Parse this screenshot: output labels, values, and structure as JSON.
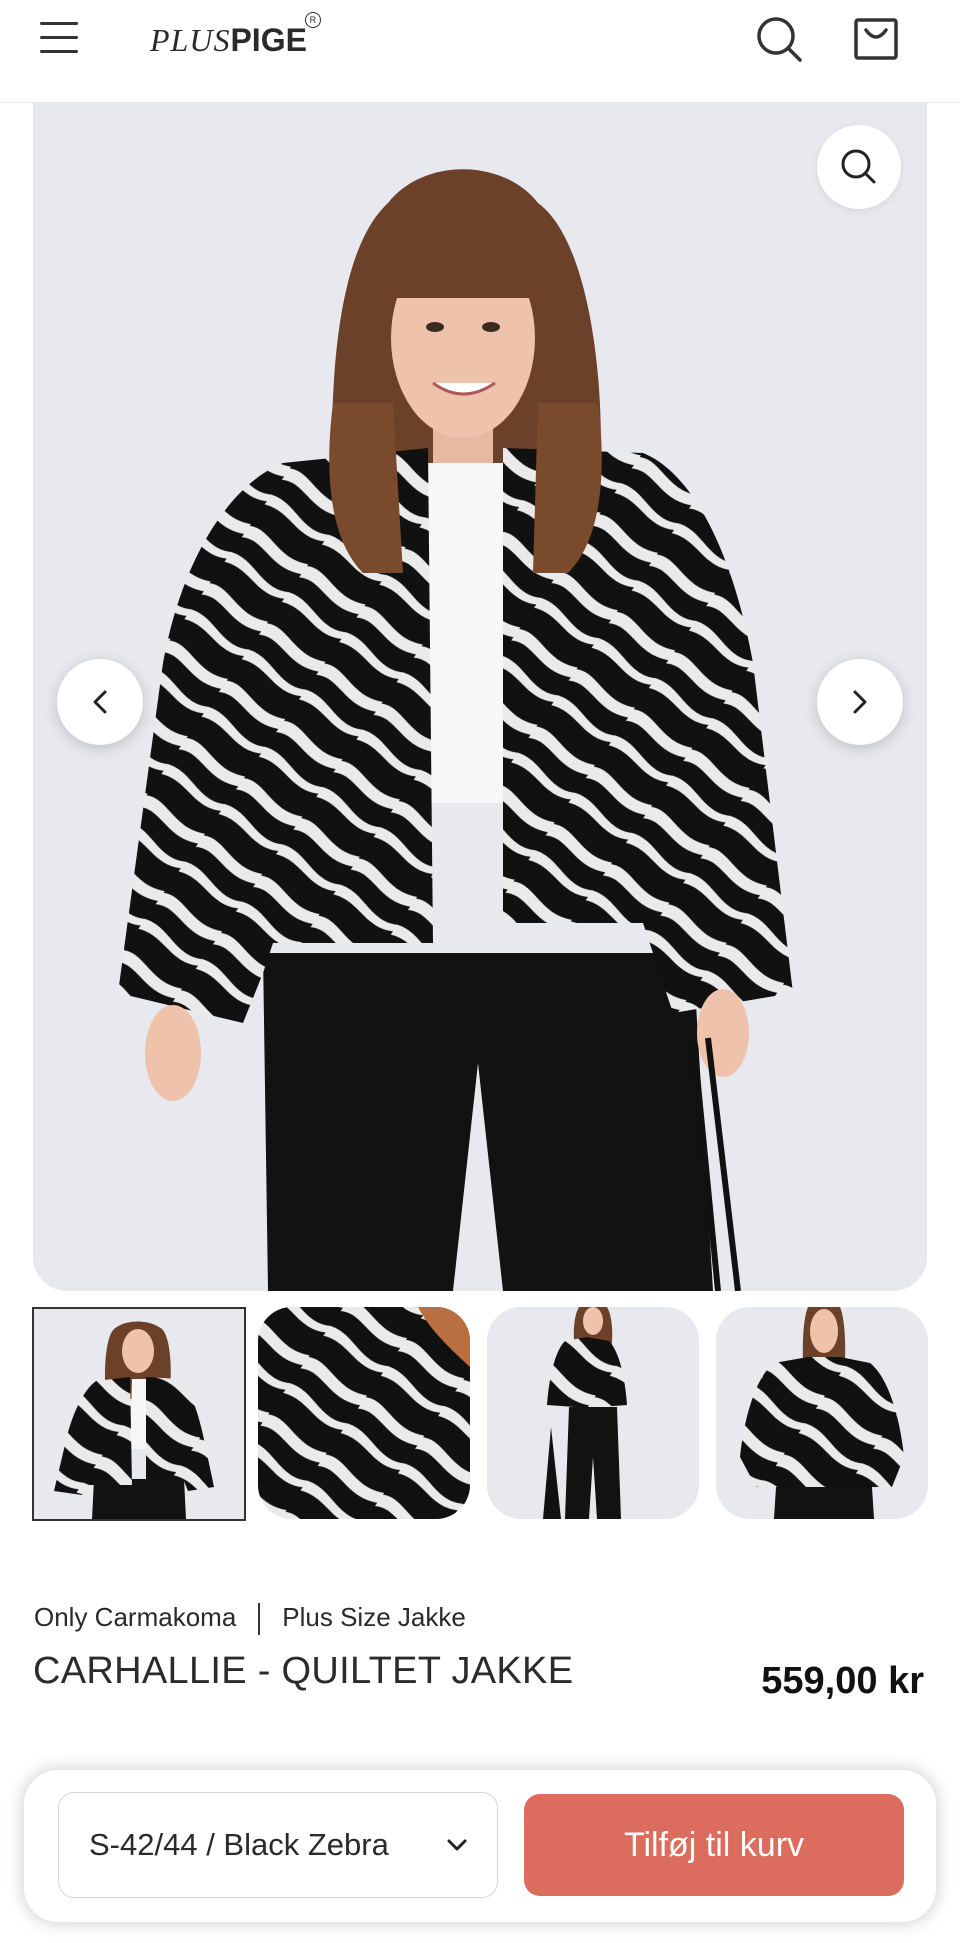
{
  "header": {
    "logo_plus": "PLUS",
    "logo_pige": "PIGE",
    "logo_reg": "R",
    "icons": [
      "menu-icon",
      "search-icon",
      "shopping-bag-icon"
    ]
  },
  "gallery": {
    "current_index": 1,
    "thumbnail_count": 4,
    "icons": [
      "zoom-icon",
      "chevron-left-icon",
      "chevron-right-icon"
    ]
  },
  "product": {
    "brand": "Only Carmakoma",
    "category": "Plus Size Jakke",
    "name": "CARHALLIE - QUILTET JAKKE",
    "price": "559,00 kr"
  },
  "purchase_bar": {
    "selected_variant": "S-42/44 / Black Zebra",
    "add_to_cart_label": "Tilføj til kurv"
  },
  "colors": {
    "accent": "#dc6c5d",
    "image_bg": "#e7e9ee",
    "text": "#1f1f1f"
  }
}
